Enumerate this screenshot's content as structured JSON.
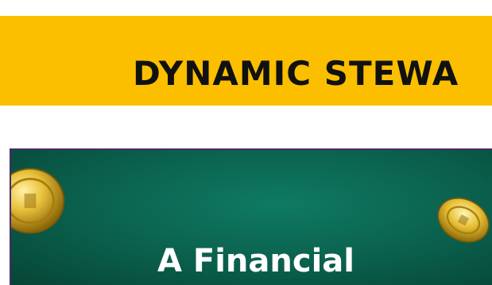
{
  "banner": {
    "title": "DYNAMIC STEWA",
    "background_color": "#fbbf00"
  },
  "promo": {
    "heading": "A Financial",
    "background_color": "#0a5f4c",
    "icons": [
      "gold-coin-icon",
      "gold-coin-icon"
    ]
  }
}
